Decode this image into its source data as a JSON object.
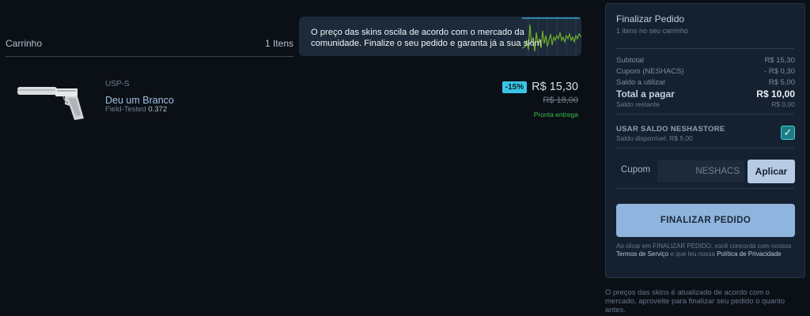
{
  "cart": {
    "title": "Carrinho",
    "count": "1 Itens"
  },
  "banner": {
    "text": "O preço das skins oscila de acordo com o mercado da comunidade. Finalize o seu pedido e garanta já a sua skin!"
  },
  "item": {
    "category": "USP-S",
    "name": "Deu um Branco",
    "wear_label": "Field-Tested",
    "float": "0.372",
    "discount": "-15%",
    "price": "R$ 15,30",
    "old_price": "R$ 18,00",
    "stock": "Pronta entrega"
  },
  "summary": {
    "title": "Finalizar Pedido",
    "subtitle": "1 itens no seu carrinho",
    "subtotal_label": "Subtotal",
    "subtotal_value": "R$ 15,30",
    "coupon_label": "Cupom (NESHACS)",
    "coupon_value": "- R$ 0,30",
    "balance_label": "Saldo a utilizar",
    "balance_value": "R$ 5,00",
    "total_label": "Total a pagar",
    "total_value": "R$ 10,00",
    "remaining_label": "Saldo restante",
    "remaining_value": "R$ 0,00",
    "use_balance_label": "USAR SALDO NESHASTORE",
    "available_balance": "Saldo disponível: R$ 5,00",
    "use_balance_checked": true,
    "coupon_field_label": "Cupom",
    "coupon_code": "NESHACS",
    "apply_label": "Aplicar",
    "finalize_label": "FINALIZAR PEDIDO",
    "legal_prefix": "Ao clicar em FINALIZAR PEDIDO, você concorda com nossos",
    "terms_link": "Termos de Serviço",
    "legal_middle": "e que leu nossa",
    "privacy_link": "Política de Privacidade"
  },
  "footer_note": "O preços das skins é atualizado de acordo com o mercado, aproveite para finalizar seu pedido o quanto antes.",
  "colors": {
    "accent": "#38c6e8",
    "button": "#8fb4dd",
    "success": "#3bbf4a",
    "panel": "#152130"
  }
}
